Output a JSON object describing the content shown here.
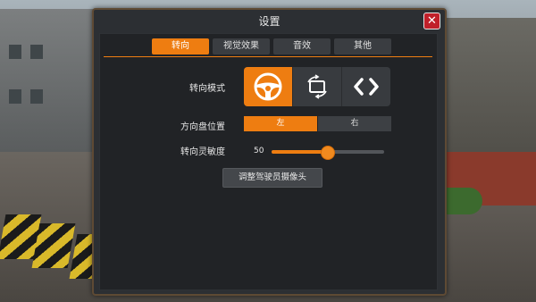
{
  "dialog": {
    "title": "设置",
    "close_icon": "close-icon"
  },
  "tabs": [
    {
      "label": "转向",
      "active": true
    },
    {
      "label": "视觉效果",
      "active": false
    },
    {
      "label": "音效",
      "active": false
    },
    {
      "label": "其他",
      "active": false
    }
  ],
  "steering": {
    "mode_label": "转向模式",
    "modes": [
      {
        "icon": "steering-wheel-icon",
        "active": true
      },
      {
        "icon": "tilt-rotate-icon",
        "active": false
      },
      {
        "icon": "arrow-buttons-icon",
        "active": false
      }
    ],
    "wheel_position_label": "方向盘位置",
    "wheel_position_options": [
      {
        "label": "左",
        "active": true
      },
      {
        "label": "右",
        "active": false
      }
    ],
    "sensitivity_label": "转向灵敏度",
    "sensitivity_value": "50",
    "sensitivity_fraction": 0.5,
    "camera_button_label": "调整驾驶员摄像头"
  },
  "colors": {
    "accent": "#ee7d11",
    "close": "#c0202a"
  }
}
